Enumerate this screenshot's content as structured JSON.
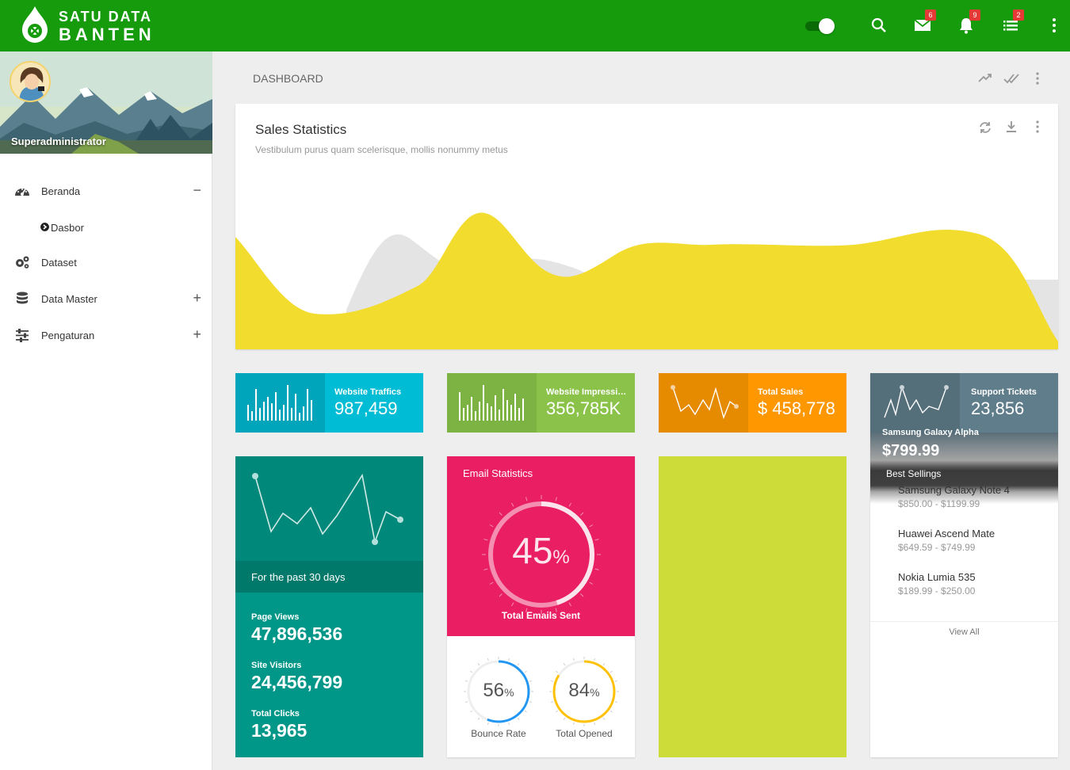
{
  "header": {
    "brand_line1": "SATU DATA",
    "brand_line2": "BANTEN",
    "mail_count": "6",
    "notif_count": "9",
    "tasks_count": "2"
  },
  "sidebar": {
    "username": "Superadministrator",
    "items": [
      {
        "label": "Beranda",
        "toggle": "−"
      },
      {
        "label": "Dasbor"
      },
      {
        "label": "Dataset"
      },
      {
        "label": "Data Master",
        "toggle": "+"
      },
      {
        "label": "Pengaturan",
        "toggle": "+"
      }
    ]
  },
  "page": {
    "breadcrumb": "DASHBOARD"
  },
  "sales": {
    "title": "Sales Statistics",
    "subtitle": "Vestibulum purus quam scelerisque, mollis nonummy metus"
  },
  "stats": [
    {
      "label": "Website Traffics",
      "value": "987,459",
      "color": "#00bcd4",
      "dark": "#00a5bb"
    },
    {
      "label": "Website Impressions",
      "value": "356,785K",
      "color": "#8bc34a",
      "dark": "#7cb342"
    },
    {
      "label": "Total Sales",
      "value": "$ 458,778",
      "color": "#ff9800",
      "dark": "#e68a00"
    },
    {
      "label": "Support Tickets",
      "value": "23,856",
      "color": "#607d8b",
      "dark": "#546e7a"
    }
  ],
  "traffic": {
    "period": "For the past 30 days",
    "kpis": [
      {
        "label": "Page Views",
        "value": "47,896,536"
      },
      {
        "label": "Site Visitors",
        "value": "24,456,799"
      },
      {
        "label": "Total Clicks",
        "value": "13,965"
      }
    ]
  },
  "email": {
    "title": "Email Statistics",
    "main_value": "45",
    "main_unit": "%",
    "main_label": "Total Emails Sent",
    "main_pct": 0.45,
    "gauges": [
      {
        "value": "56",
        "unit": "%",
        "label": "Bounce Rate",
        "pct": 0.56,
        "color": "#2196f3"
      },
      {
        "value": "84",
        "unit": "%",
        "label": "Total Opened",
        "pct": 0.84,
        "color": "#ffc107"
      }
    ]
  },
  "best": {
    "hero_name": "Samsung Galaxy Alpha",
    "hero_price": "$799.99",
    "section_label": "Best Sellings",
    "products": [
      {
        "name": "Samsung Galaxy Note 4",
        "price": "$850.00 - $1199.99"
      },
      {
        "name": "Huawei Ascend Mate",
        "price": "$649.59 - $749.99"
      },
      {
        "name": "Nokia Lumia 535",
        "price": "$189.99 - $250.00"
      }
    ],
    "view_all": "View All"
  }
}
